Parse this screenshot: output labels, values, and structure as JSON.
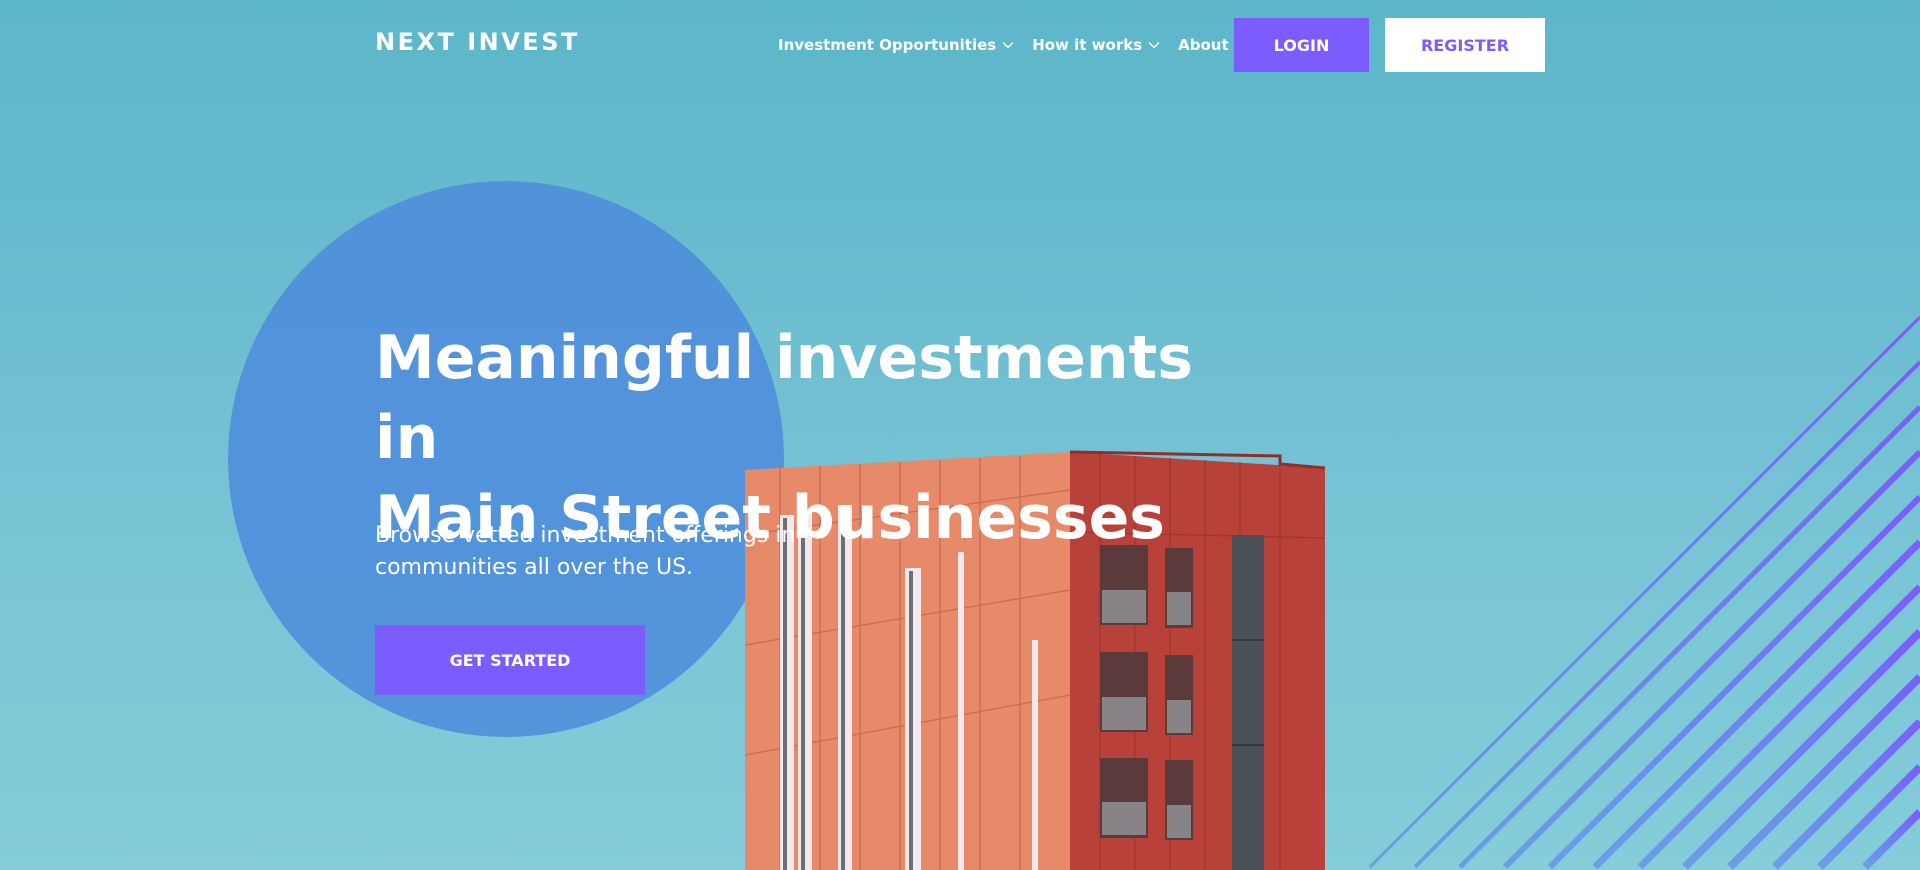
{
  "header": {
    "logo": "NEXT INVEST",
    "nav": [
      {
        "label": "Investment Opportunities",
        "dropdown": true
      },
      {
        "label": "How it works",
        "dropdown": true
      },
      {
        "label": "About us",
        "dropdown": false
      }
    ],
    "login_label": "LOGIN",
    "register_label": "REGISTER"
  },
  "hero": {
    "title_line1": "Meaningful investments in",
    "title_line2": "Main Street businesses",
    "subtitle_line1": "Browse vetted investment offerings in",
    "subtitle_line2": "communities all over the US.",
    "cta_label": "GET STARTED"
  },
  "colors": {
    "accent": "#7b5cff",
    "background": "#6cbdd0",
    "circle": "#4f8fdb",
    "building": "#d86b4e"
  },
  "icons": {
    "nav_dropdown": "chevron-down-icon"
  }
}
